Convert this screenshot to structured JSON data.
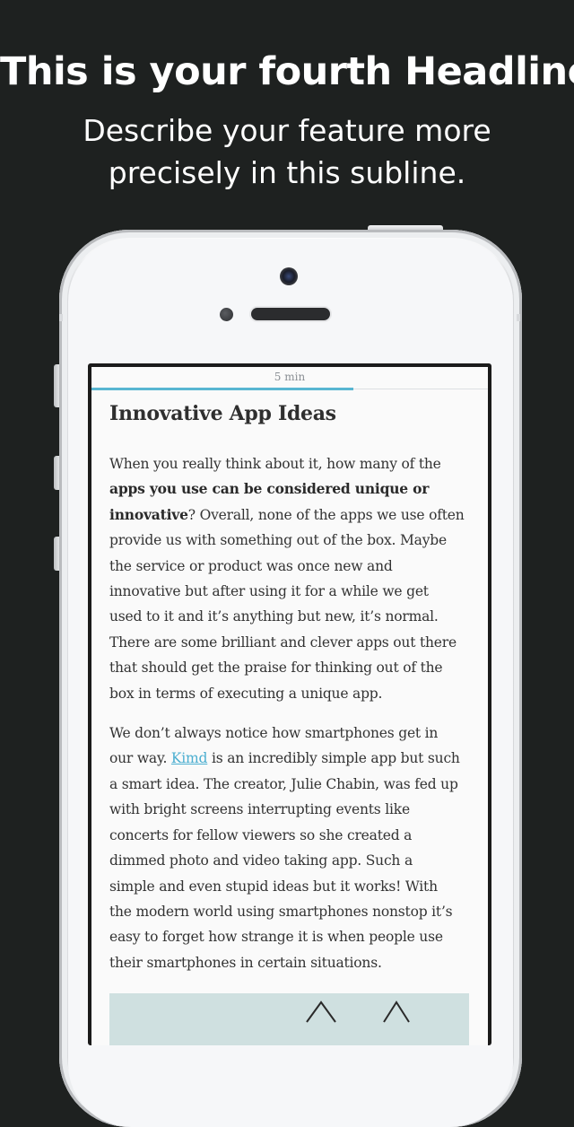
{
  "promo": {
    "headline": "This is your fourth Headline",
    "subline_line1": "Describe your feature more",
    "subline_line2": "precisely in this subline."
  },
  "reader": {
    "reading_time": "5 min",
    "progress_fraction": 0.66,
    "title": "Innovative App Ideas",
    "paragraph1": {
      "l1": "When you really think about it, how many of the",
      "l2_bold": "apps you use can be considered unique or",
      "l3_bold": "innovative",
      "l3": "? Overall, none of the apps we use often",
      "l4": "provide us with something out of the box. Maybe",
      "l5": "the service or product was once new and",
      "l6": "innovative but after using it for a while we get",
      "l7": "used to it and it’s anything but new, it’s normal.",
      "l8": "There are some brilliant and clever apps out there",
      "l9": "that should get the praise for thinking out of the",
      "l10": "box in terms of executing a unique app."
    },
    "paragraph2": {
      "l1": "We don’t always notice how smartphones get in",
      "l2_pre": "our way. ",
      "l2_link": "Kimd",
      "l2_post": " is an incredibly simple app but such",
      "l3": "a smart idea. The creator, Julie Chabin, was fed up",
      "l4": "with bright screens interrupting events like",
      "l5": "concerts for fellow viewers so she created a",
      "l6": "dimmed photo and video taking app. Such a",
      "l7": "simple and even stupid ideas but it works! With",
      "l8": "the modern world using smartphones nonstop it’s",
      "l9": "easy to forget how strange it is when people use",
      "l10": "their smartphones in certain situations."
    }
  },
  "colors": {
    "background": "#1e2120",
    "accent": "#58b6d2",
    "link": "#4aaed0"
  }
}
